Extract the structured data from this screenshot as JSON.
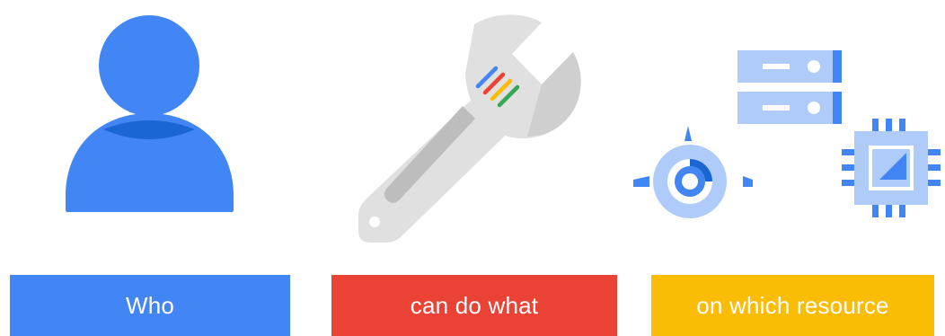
{
  "columns": [
    {
      "label": "Who",
      "color": "#4285f4",
      "icon": "person-icon"
    },
    {
      "label": "can do what",
      "color": "#ea4335",
      "icon": "wrench-icon"
    },
    {
      "label": "on which resource",
      "color": "#fbbc05",
      "icon": "cloud-resources-icon"
    }
  ],
  "colors": {
    "blue": "#4285f4",
    "dark_blue": "#1a66d2",
    "light_blue": "#aecbfa",
    "red": "#ea4335",
    "yellow": "#fbbc05",
    "green": "#34a853",
    "gray": "#e0e0e0",
    "dark_gray": "#bdbdbd"
  }
}
